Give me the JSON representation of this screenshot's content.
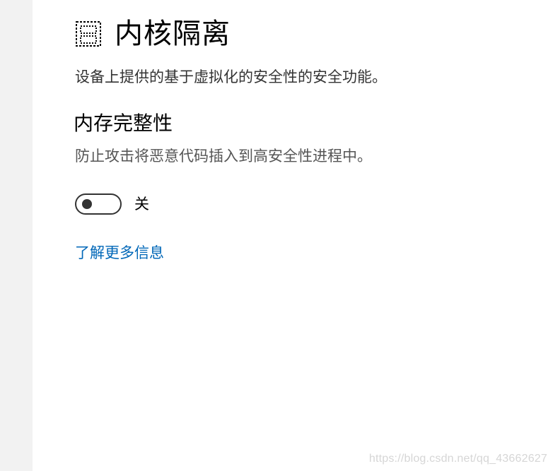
{
  "page": {
    "title": "内核隔离",
    "description": "设备上提供的基于虚拟化的安全性的安全功能。"
  },
  "memory_integrity": {
    "title": "内存完整性",
    "description": "防止攻击将恶意代码插入到高安全性进程中。",
    "toggle_state_label": "关",
    "toggle_on": false
  },
  "links": {
    "learn_more": "了解更多信息"
  },
  "watermark": "https://blog.csdn.net/qq_43662627",
  "icons": {
    "header_icon": "core-isolation-icon",
    "toggle_knob": "toggle-knob-icon"
  },
  "colors": {
    "accent_link": "#0067b8",
    "sidebar_bg": "#f2f2f2",
    "toggle_off": "#333333"
  }
}
